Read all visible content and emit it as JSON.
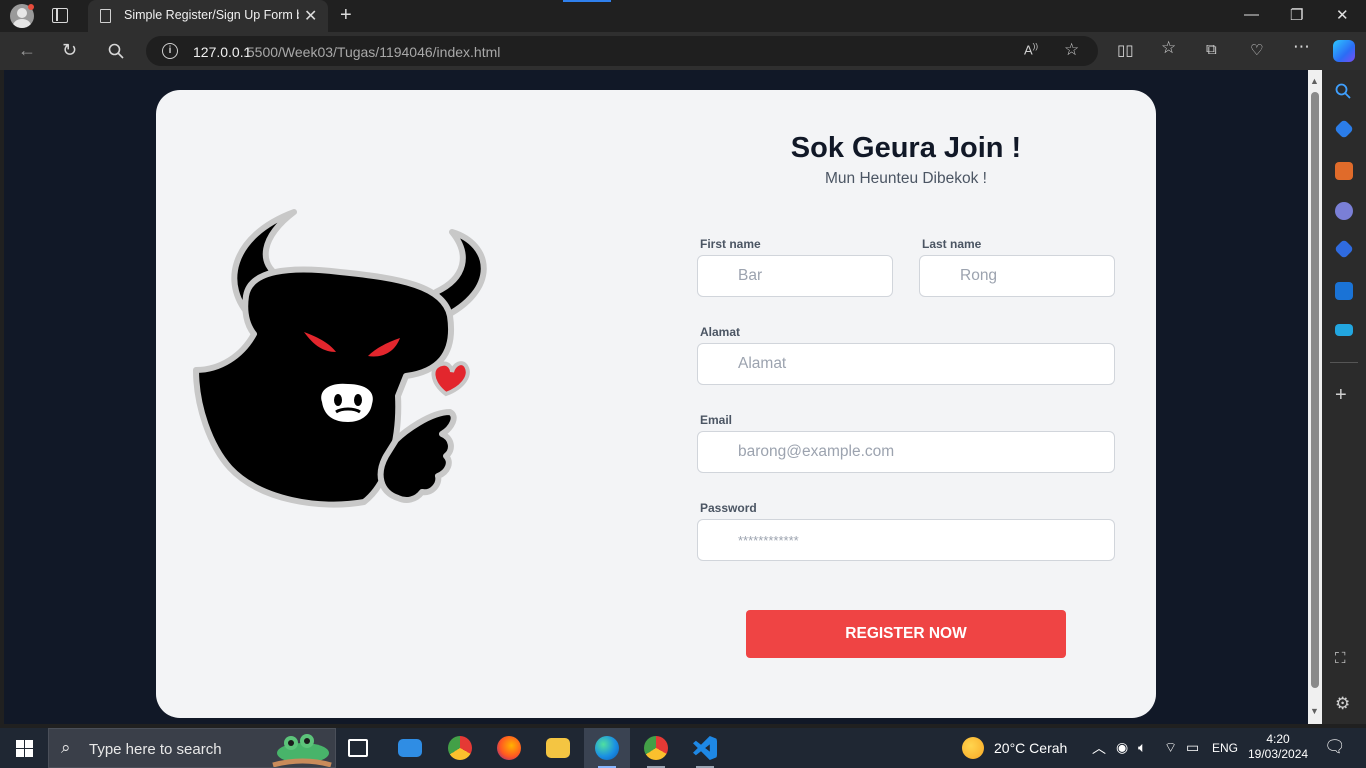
{
  "browser": {
    "tab_title": "Simple Register/Sign Up Form by",
    "url_host": "127.0.0.1",
    "url_path": ":5500/Week03/Tugas/1194046/index.html"
  },
  "page": {
    "heading": "Sok Geura Join !",
    "subheading": "Mun Heunteu Dibekok !",
    "fields": {
      "first_name": {
        "label": "First name",
        "placeholder": "Bar"
      },
      "last_name": {
        "label": "Last name",
        "placeholder": "Rong"
      },
      "address": {
        "label": "Alamat",
        "placeholder": "Alamat"
      },
      "email": {
        "label": "Email",
        "placeholder": "barong@example.com"
      },
      "password": {
        "label": "Password",
        "placeholder": "************"
      }
    },
    "register_label": "REGISTER NOW",
    "accent_color": "#ef4444"
  },
  "taskbar": {
    "search_placeholder": "Type here to search",
    "weather": "20°C  Cerah",
    "language": "ENG",
    "time": "4:20",
    "date": "19/03/2024"
  }
}
